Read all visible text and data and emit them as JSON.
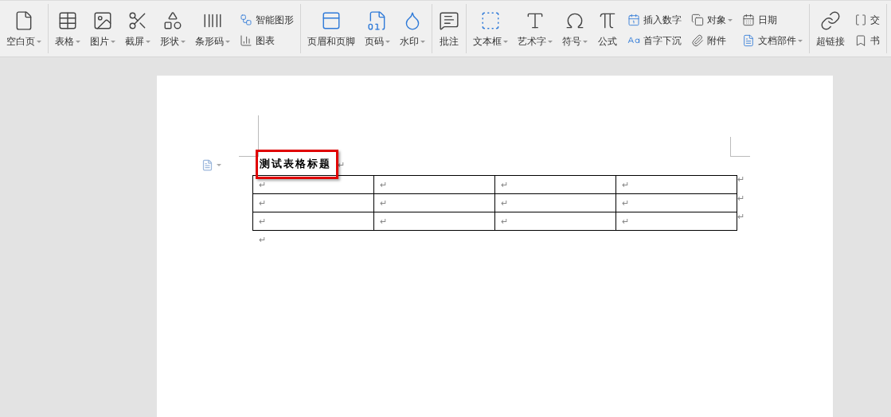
{
  "toolbar": {
    "groups": [
      [
        {
          "kind": "large",
          "label": "空白页",
          "dropdown": true
        }
      ],
      [
        {
          "kind": "large",
          "label": "表格",
          "dropdown": true
        },
        {
          "kind": "large",
          "label": "图片",
          "dropdown": true
        },
        {
          "kind": "large",
          "label": "截屏",
          "dropdown": true
        },
        {
          "kind": "large",
          "label": "形状",
          "dropdown": true
        },
        {
          "kind": "large",
          "label": "条形码",
          "dropdown": true
        },
        {
          "kind": "stack",
          "items": [
            {
              "label": "智能图形",
              "dropdown": false
            },
            {
              "label": "图表",
              "dropdown": false
            }
          ]
        }
      ],
      [
        {
          "kind": "large",
          "label": "页眉和页脚",
          "dropdown": false
        },
        {
          "kind": "large",
          "label": "页码",
          "dropdown": true
        },
        {
          "kind": "large",
          "label": "水印",
          "dropdown": true
        }
      ],
      [
        {
          "kind": "large",
          "label": "批注",
          "dropdown": false
        }
      ],
      [
        {
          "kind": "large",
          "label": "文本框",
          "dropdown": true
        },
        {
          "kind": "large",
          "label": "艺术字",
          "dropdown": true
        },
        {
          "kind": "large",
          "label": "符号",
          "dropdown": true
        },
        {
          "kind": "large",
          "label": "公式",
          "dropdown": false
        },
        {
          "kind": "stack",
          "items": [
            {
              "label": "插入数字",
              "dropdown": false
            },
            {
              "label": "首字下沉",
              "dropdown": false
            }
          ]
        },
        {
          "kind": "stack",
          "items": [
            {
              "label": "对象",
              "dropdown": true
            },
            {
              "label": "附件",
              "dropdown": false
            }
          ]
        },
        {
          "kind": "stack",
          "items": [
            {
              "label": "日期",
              "dropdown": false
            },
            {
              "label": "文档部件",
              "dropdown": true
            }
          ]
        }
      ],
      [
        {
          "kind": "large",
          "label": "超链接",
          "dropdown": false
        },
        {
          "kind": "stack",
          "items": [
            {
              "label": "交",
              "dropdown": false
            },
            {
              "label": "书",
              "dropdown": false
            }
          ]
        }
      ]
    ]
  },
  "document": {
    "title": {
      "text": "测试表格标题",
      "mark": "↵",
      "highlighted": true
    },
    "table": {
      "rows": [
        {
          "cells": [
            "↵",
            "↵",
            "↵",
            "↵"
          ],
          "end_mark": "↵"
        },
        {
          "cells": [
            "↵",
            "↵",
            "↵",
            "↵"
          ],
          "end_mark": "↵"
        },
        {
          "cells": [
            "↵",
            "↵",
            "↵",
            "↵"
          ],
          "end_mark": "↵"
        }
      ]
    },
    "after_mark": "↵"
  }
}
